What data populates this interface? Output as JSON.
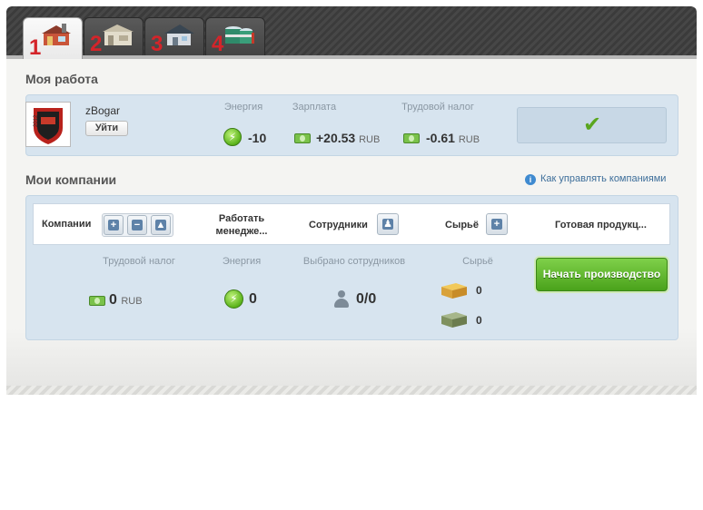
{
  "tabs": [
    {
      "number": "1",
      "icon": "factory-icon",
      "active": true
    },
    {
      "number": "2",
      "icon": "warehouse-icon",
      "active": false
    },
    {
      "number": "3",
      "icon": "house-icon",
      "active": false
    },
    {
      "number": "4",
      "icon": "oil-tanks-icon",
      "active": false
    }
  ],
  "my_job": {
    "title": "Моя работа",
    "employer": "zBogar",
    "leave_label": "Уйти",
    "energy_label": "Энергия",
    "energy_value": "-10",
    "salary_label": "Зарплата",
    "salary_value": "+20.53",
    "salary_currency": "RUB",
    "tax_label": "Трудовой налог",
    "tax_value": "-0.61",
    "tax_currency": "RUB"
  },
  "companies": {
    "title": "Мои компании",
    "help_link": "Как управлять компаниями",
    "header": {
      "companies": "Компании",
      "managing": "Работать менедже...",
      "employees": "Сотрудники",
      "raw": "Сырьё",
      "product": "Готовая продукц..."
    },
    "summary": {
      "tax_label": "Трудовой налог",
      "tax_value": "0",
      "tax_currency": "RUB",
      "energy_label": "Энергия",
      "energy_value": "0",
      "selected_label": "Выбрано сотрудников",
      "selected_value": "0/0",
      "raw_label": "Сырьё",
      "raw_food": "0",
      "raw_weapon": "0"
    },
    "start_button": "Начать производство"
  },
  "colors": {
    "tab_number": "#d4242a",
    "panel": "#d7e4ef",
    "start_button": "#5fb82c",
    "check": "#5aa61f"
  }
}
